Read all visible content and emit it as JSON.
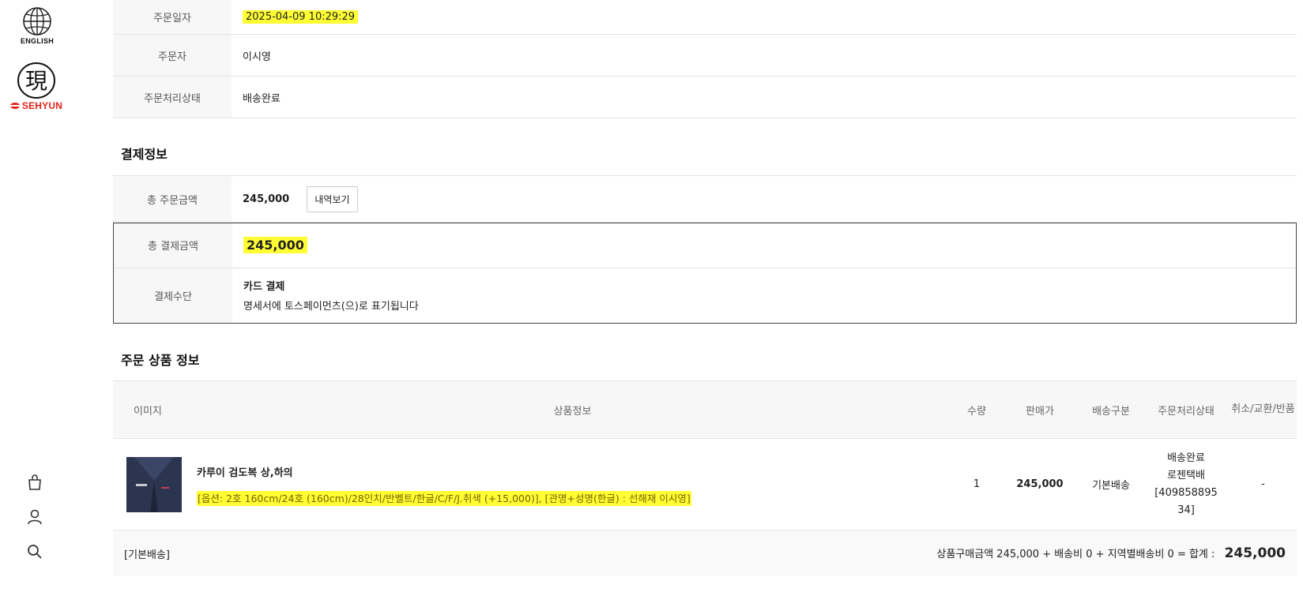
{
  "sidebar": {
    "language_label": "ENGLISH",
    "brand_name": "SEHYUN",
    "logo_glyph": "現",
    "icons": [
      "shopping-bag-icon",
      "user-icon",
      "search-icon"
    ]
  },
  "order_info": {
    "rows": [
      {
        "label": "주문일자",
        "value": "2025-04-09 10:29:29"
      },
      {
        "label": "주문자",
        "value": "이시영"
      },
      {
        "label": "주문처리상태",
        "value": "배송완료"
      }
    ]
  },
  "payment": {
    "title": "결제정보",
    "total_order_label": "총 주문금액",
    "total_order_value": "245,000",
    "details_button": "내역보기",
    "total_payment_label": "총 결제금액",
    "total_payment_value": "245,000",
    "method_label": "결제수단",
    "method_value": "카드 결제",
    "method_note": "명세서에 토스페이먼츠(으)로 표기됩니다"
  },
  "products": {
    "title": "주문 상품 정보",
    "headers": [
      "이미지",
      "상품정보",
      "수량",
      "판매가",
      "배송구분",
      "주문처리상태",
      "취소/교환/반품"
    ],
    "item": {
      "name": "카루이 검도복 상,하의",
      "options": "[옵션: 2호 160cm/24호 (160cm)/28인치/반벨트/한글/C/F/J.취색 (+15,000)], [관명+성명(한글) : 선해재 이시영]",
      "quantity": "1",
      "price": "245,000",
      "shipping_type": "기본배송",
      "status_lines": [
        "배송완료",
        "로젠택배",
        "[409858895",
        "34]"
      ],
      "cancel": "-"
    },
    "footer": {
      "shipping_label": "[기본배송]",
      "summary": "상품구매금액 245,000 + 배송비 0 + 지역별배송비 0 = 합계 :",
      "total": "245,000"
    }
  },
  "colors": {
    "highlight": "#ffff33",
    "brand_red": "#e2231a",
    "header_bg": "#f7f7f7"
  }
}
